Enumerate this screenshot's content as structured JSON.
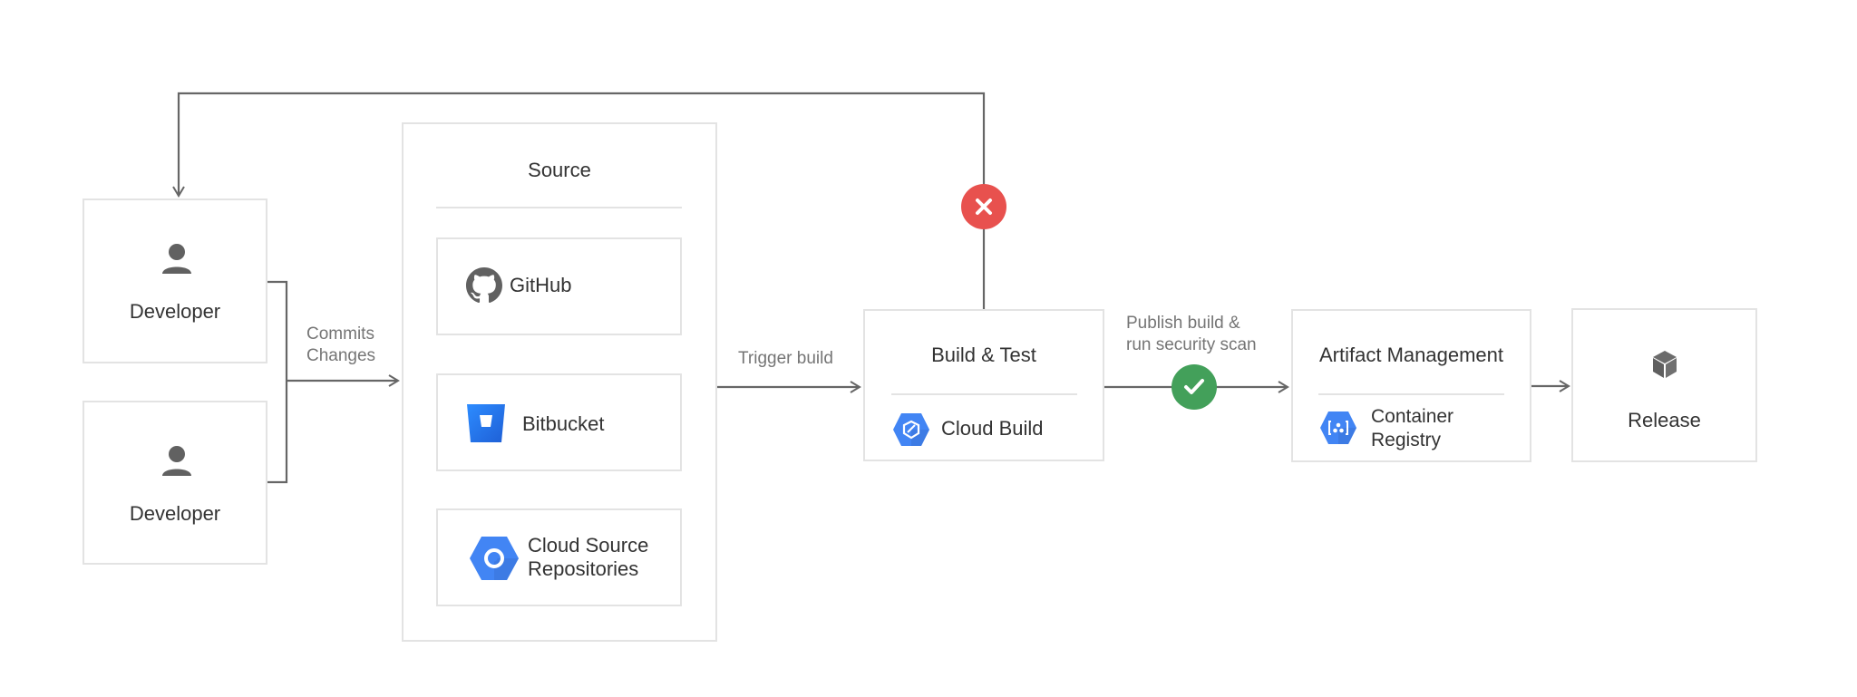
{
  "diagram": {
    "developers": [
      {
        "label": "Developer",
        "icon": "person-icon"
      },
      {
        "label": "Developer",
        "icon": "person-icon"
      }
    ],
    "edges": {
      "commits": {
        "line1": "Commits",
        "line2": "Changes"
      },
      "trigger": "Trigger build",
      "publish": {
        "line1": "Publish build &",
        "line2": "run security scan"
      }
    },
    "source": {
      "title": "Source",
      "items": [
        {
          "label": "GitHub",
          "icon": "github-icon"
        },
        {
          "label": "Bitbucket",
          "icon": "bitbucket-icon"
        },
        {
          "label_line1": "Cloud Source",
          "label_line2": "Repositories",
          "icon": "cloud-source-repositories-icon"
        }
      ]
    },
    "build": {
      "title": "Build & Test",
      "service": "Cloud Build",
      "icon": "cloud-build-icon"
    },
    "artifact": {
      "title": "Artifact Management",
      "service_line1": "Container",
      "service_line2": "Registry",
      "icon": "container-registry-icon"
    },
    "release": {
      "label": "Release",
      "icon": "cube-icon"
    },
    "status": {
      "fail": {
        "icon": "close-icon",
        "color": "#e8514e"
      },
      "pass": {
        "icon": "check-icon",
        "color": "#43a05a"
      }
    },
    "colors": {
      "line": "#666666",
      "border": "#e3e3e3",
      "gcp_blue": "#4285f4",
      "bitbucket_blue": "#2684ff"
    }
  }
}
